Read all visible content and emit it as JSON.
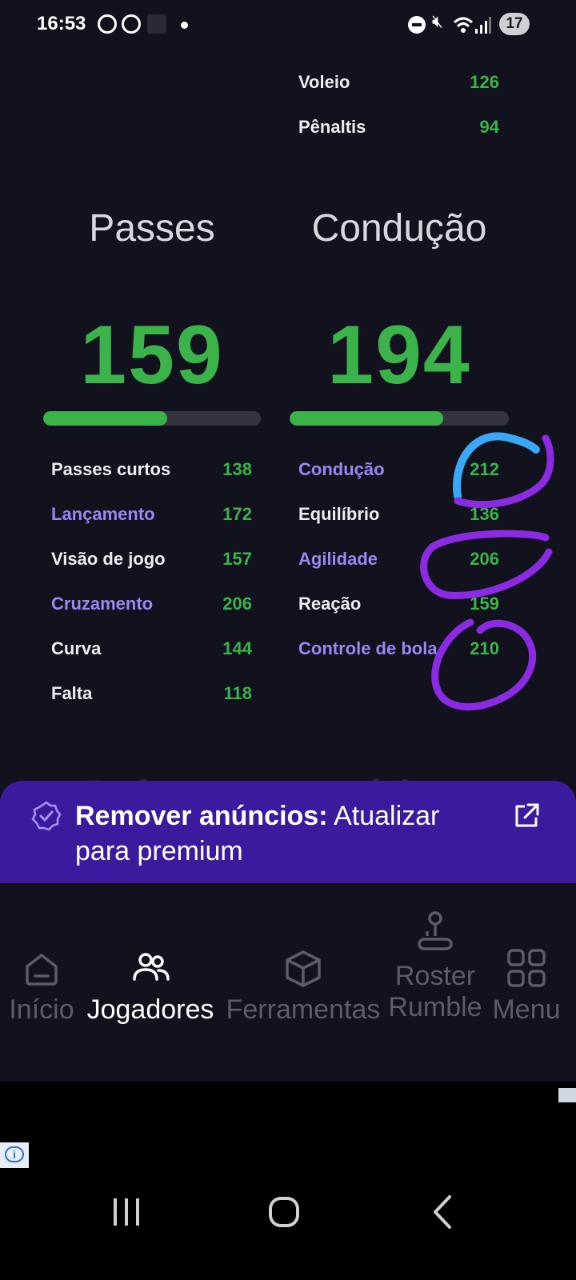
{
  "status_bar": {
    "time": "16:53",
    "battery": "17"
  },
  "top_rows": [
    {
      "label": "Voleio",
      "value": "126"
    },
    {
      "label": "Pênaltis",
      "value": "94"
    }
  ],
  "passes": {
    "title": "Passes",
    "score": "159",
    "progress": 0.57,
    "rows": [
      {
        "label": "Passes curtos",
        "value": "138"
      },
      {
        "label": "Lançamento",
        "value": "172"
      },
      {
        "label": "Visão de jogo",
        "value": "157"
      },
      {
        "label": "Cruzamento",
        "value": "206"
      },
      {
        "label": "Curva",
        "value": "144"
      },
      {
        "label": "Falta",
        "value": "118"
      }
    ]
  },
  "conducao": {
    "title": "Condução",
    "score": "194",
    "progress": 0.7,
    "rows": [
      {
        "label": "Condução",
        "value": "212"
      },
      {
        "label": "Equilíbrio",
        "value": "136"
      },
      {
        "label": "Agilidade",
        "value": "206"
      },
      {
        "label": "Reação",
        "value": "159"
      },
      {
        "label": "Controle de bola",
        "value": "210"
      }
    ]
  },
  "hidden_sections": {
    "left": "Defesa",
    "right": "Físico"
  },
  "premium_banner": {
    "bold": "Remover anúncios:",
    "text": " Atualizar para premium"
  },
  "bottom_nav": [
    {
      "label": "Início",
      "icon": "home-icon"
    },
    {
      "label": "Jogadores",
      "icon": "users-icon",
      "active": true
    },
    {
      "label": "Ferramentas",
      "icon": "box-icon"
    },
    {
      "label": "Roster",
      "sublabel": "Rumble",
      "icon": "joystick-icon"
    },
    {
      "label": "Menu",
      "icon": "grid-icon"
    }
  ],
  "colors": {
    "accent_green": "#3bb34a",
    "purple_label": "#9b86f2",
    "banner": "#3b1a9e",
    "background": "#12121f"
  }
}
